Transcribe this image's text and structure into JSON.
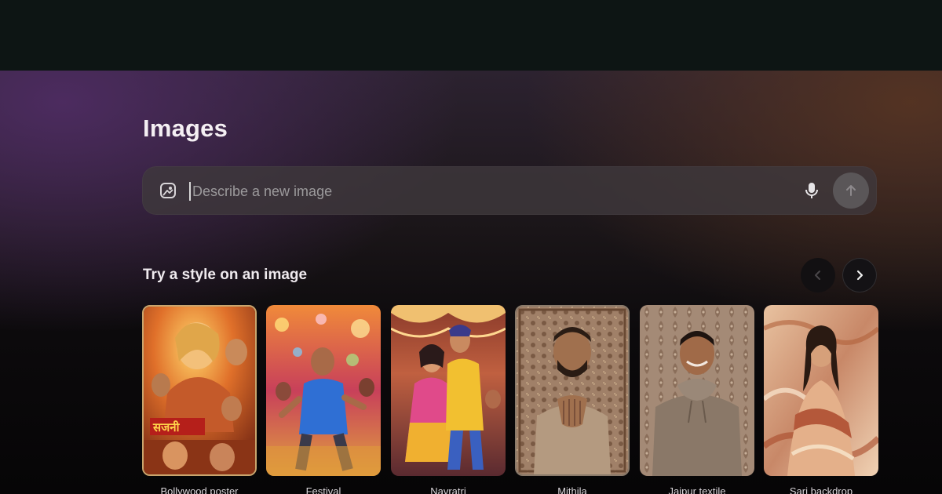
{
  "page": {
    "title": "Images"
  },
  "search": {
    "placeholder": "Describe a new image",
    "value": "",
    "left_icon": "image-icon",
    "mic_icon": "microphone-icon",
    "send_icon": "arrow-up-icon"
  },
  "styles_section": {
    "title": "Try a style on an image",
    "prev_icon": "chevron-left-icon",
    "next_icon": "chevron-right-icon",
    "cards": [
      {
        "label": "Bollywood poster"
      },
      {
        "label": "Festival"
      },
      {
        "label": "Navratri"
      },
      {
        "label": "Mithila"
      },
      {
        "label": "Jaipur textile"
      },
      {
        "label": "Sari backdrop"
      }
    ]
  },
  "colors": {
    "top_bar": "#0d1514",
    "gradient_purple": "#4e2c62",
    "gradient_brown": "#563422",
    "search_bg": "#3e383c",
    "send_button": "#5a5658"
  }
}
